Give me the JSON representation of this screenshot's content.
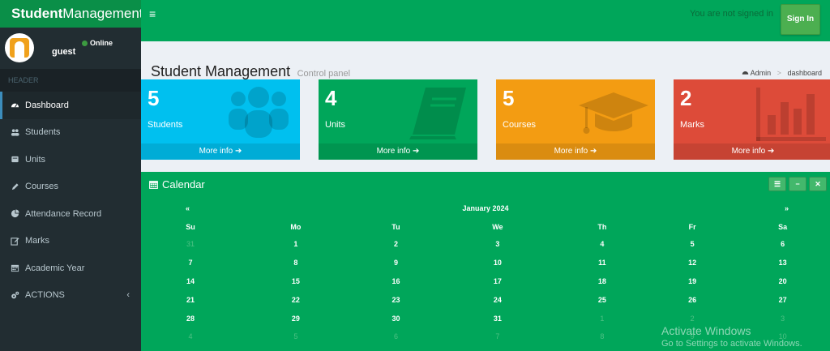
{
  "logo": {
    "bold": "Student",
    "rest": "Management"
  },
  "navbar": {
    "toggle": "≡",
    "not_signed_text": "You are not signed in",
    "signin_label": "Sign In"
  },
  "user": {
    "name": "guest",
    "status": "Online"
  },
  "sidebar": {
    "header": "HEADER",
    "items": [
      {
        "label": "Dashboard",
        "icon": "dashboard-icon",
        "active": true
      },
      {
        "label": "Students",
        "icon": "users-icon"
      },
      {
        "label": "Units",
        "icon": "book-icon"
      },
      {
        "label": "Courses",
        "icon": "pencil-icon"
      },
      {
        "label": "Attendance Record",
        "icon": "pie-chart-icon"
      },
      {
        "label": "Marks",
        "icon": "edit-icon"
      },
      {
        "label": "Academic Year",
        "icon": "calendar-icon"
      },
      {
        "label": "ACTIONS",
        "icon": "cogs-icon",
        "chevron": "‹"
      }
    ]
  },
  "content": {
    "title": "Student Management",
    "subtitle": "Control panel"
  },
  "breadcrumb": {
    "home": "Admin",
    "sep": ">",
    "current": "dashboard"
  },
  "boxes": [
    {
      "number": "5",
      "label": "Students",
      "more": "More info",
      "color": "#00c0ef",
      "icon": "users-icon"
    },
    {
      "number": "4",
      "label": "Units",
      "more": "More info",
      "color": "#00a65a",
      "icon": "book-icon"
    },
    {
      "number": "5",
      "label": "Courses",
      "more": "More info",
      "color": "#f39c12",
      "icon": "graduation-cap-icon"
    },
    {
      "number": "2",
      "label": "Marks",
      "more": "More info",
      "color": "#dd4b39",
      "icon": "bar-chart-icon"
    }
  ],
  "calendar": {
    "title": "Calendar",
    "prev": "«",
    "next": "»",
    "month": "January 2024",
    "weekdays": [
      "Su",
      "Mo",
      "Tu",
      "We",
      "Th",
      "Fr",
      "Sa"
    ],
    "weeks": [
      [
        {
          "d": "31",
          "m": true
        },
        {
          "d": "1"
        },
        {
          "d": "2"
        },
        {
          "d": "3"
        },
        {
          "d": "4"
        },
        {
          "d": "5"
        },
        {
          "d": "6"
        }
      ],
      [
        {
          "d": "7"
        },
        {
          "d": "8"
        },
        {
          "d": "9"
        },
        {
          "d": "10"
        },
        {
          "d": "11"
        },
        {
          "d": "12"
        },
        {
          "d": "13"
        }
      ],
      [
        {
          "d": "14"
        },
        {
          "d": "15"
        },
        {
          "d": "16"
        },
        {
          "d": "17"
        },
        {
          "d": "18"
        },
        {
          "d": "19"
        },
        {
          "d": "20"
        }
      ],
      [
        {
          "d": "21"
        },
        {
          "d": "22"
        },
        {
          "d": "23"
        },
        {
          "d": "24"
        },
        {
          "d": "25"
        },
        {
          "d": "26"
        },
        {
          "d": "27"
        }
      ],
      [
        {
          "d": "28"
        },
        {
          "d": "29"
        },
        {
          "d": "30"
        },
        {
          "d": "31"
        },
        {
          "d": "1",
          "m": true
        },
        {
          "d": "2",
          "m": true
        },
        {
          "d": "3",
          "m": true
        }
      ],
      [
        {
          "d": "4",
          "m": true
        },
        {
          "d": "5",
          "m": true
        },
        {
          "d": "6",
          "m": true
        },
        {
          "d": "7",
          "m": true
        },
        {
          "d": "8",
          "m": true
        },
        {
          "d": "9",
          "m": true
        },
        {
          "d": "10",
          "m": true
        }
      ]
    ]
  },
  "watermark": {
    "line1": "Activate Windows",
    "line2": "Go to Settings to activate Windows."
  }
}
